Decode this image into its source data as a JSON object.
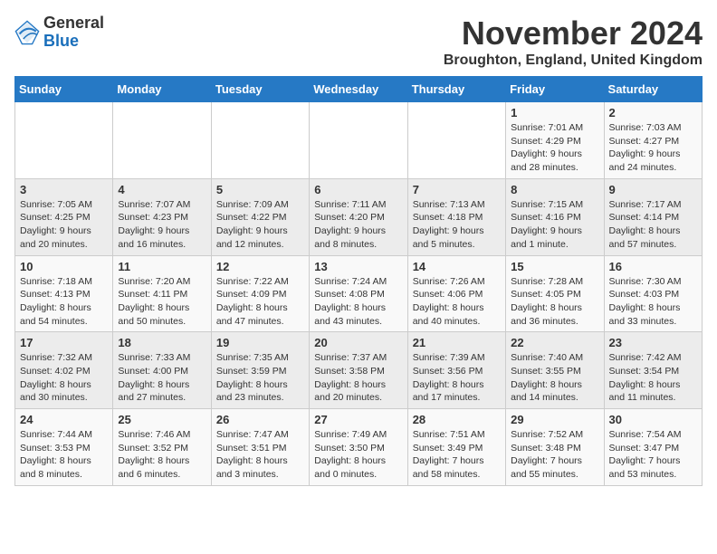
{
  "logo": {
    "general": "General",
    "blue": "Blue"
  },
  "header": {
    "month": "November 2024",
    "location": "Broughton, England, United Kingdom"
  },
  "days_of_week": [
    "Sunday",
    "Monday",
    "Tuesday",
    "Wednesday",
    "Thursday",
    "Friday",
    "Saturday"
  ],
  "weeks": [
    [
      {
        "day": "",
        "info": ""
      },
      {
        "day": "",
        "info": ""
      },
      {
        "day": "",
        "info": ""
      },
      {
        "day": "",
        "info": ""
      },
      {
        "day": "",
        "info": ""
      },
      {
        "day": "1",
        "info": "Sunrise: 7:01 AM\nSunset: 4:29 PM\nDaylight: 9 hours and 28 minutes."
      },
      {
        "day": "2",
        "info": "Sunrise: 7:03 AM\nSunset: 4:27 PM\nDaylight: 9 hours and 24 minutes."
      }
    ],
    [
      {
        "day": "3",
        "info": "Sunrise: 7:05 AM\nSunset: 4:25 PM\nDaylight: 9 hours and 20 minutes."
      },
      {
        "day": "4",
        "info": "Sunrise: 7:07 AM\nSunset: 4:23 PM\nDaylight: 9 hours and 16 minutes."
      },
      {
        "day": "5",
        "info": "Sunrise: 7:09 AM\nSunset: 4:22 PM\nDaylight: 9 hours and 12 minutes."
      },
      {
        "day": "6",
        "info": "Sunrise: 7:11 AM\nSunset: 4:20 PM\nDaylight: 9 hours and 8 minutes."
      },
      {
        "day": "7",
        "info": "Sunrise: 7:13 AM\nSunset: 4:18 PM\nDaylight: 9 hours and 5 minutes."
      },
      {
        "day": "8",
        "info": "Sunrise: 7:15 AM\nSunset: 4:16 PM\nDaylight: 9 hours and 1 minute."
      },
      {
        "day": "9",
        "info": "Sunrise: 7:17 AM\nSunset: 4:14 PM\nDaylight: 8 hours and 57 minutes."
      }
    ],
    [
      {
        "day": "10",
        "info": "Sunrise: 7:18 AM\nSunset: 4:13 PM\nDaylight: 8 hours and 54 minutes."
      },
      {
        "day": "11",
        "info": "Sunrise: 7:20 AM\nSunset: 4:11 PM\nDaylight: 8 hours and 50 minutes."
      },
      {
        "day": "12",
        "info": "Sunrise: 7:22 AM\nSunset: 4:09 PM\nDaylight: 8 hours and 47 minutes."
      },
      {
        "day": "13",
        "info": "Sunrise: 7:24 AM\nSunset: 4:08 PM\nDaylight: 8 hours and 43 minutes."
      },
      {
        "day": "14",
        "info": "Sunrise: 7:26 AM\nSunset: 4:06 PM\nDaylight: 8 hours and 40 minutes."
      },
      {
        "day": "15",
        "info": "Sunrise: 7:28 AM\nSunset: 4:05 PM\nDaylight: 8 hours and 36 minutes."
      },
      {
        "day": "16",
        "info": "Sunrise: 7:30 AM\nSunset: 4:03 PM\nDaylight: 8 hours and 33 minutes."
      }
    ],
    [
      {
        "day": "17",
        "info": "Sunrise: 7:32 AM\nSunset: 4:02 PM\nDaylight: 8 hours and 30 minutes."
      },
      {
        "day": "18",
        "info": "Sunrise: 7:33 AM\nSunset: 4:00 PM\nDaylight: 8 hours and 27 minutes."
      },
      {
        "day": "19",
        "info": "Sunrise: 7:35 AM\nSunset: 3:59 PM\nDaylight: 8 hours and 23 minutes."
      },
      {
        "day": "20",
        "info": "Sunrise: 7:37 AM\nSunset: 3:58 PM\nDaylight: 8 hours and 20 minutes."
      },
      {
        "day": "21",
        "info": "Sunrise: 7:39 AM\nSunset: 3:56 PM\nDaylight: 8 hours and 17 minutes."
      },
      {
        "day": "22",
        "info": "Sunrise: 7:40 AM\nSunset: 3:55 PM\nDaylight: 8 hours and 14 minutes."
      },
      {
        "day": "23",
        "info": "Sunrise: 7:42 AM\nSunset: 3:54 PM\nDaylight: 8 hours and 11 minutes."
      }
    ],
    [
      {
        "day": "24",
        "info": "Sunrise: 7:44 AM\nSunset: 3:53 PM\nDaylight: 8 hours and 8 minutes."
      },
      {
        "day": "25",
        "info": "Sunrise: 7:46 AM\nSunset: 3:52 PM\nDaylight: 8 hours and 6 minutes."
      },
      {
        "day": "26",
        "info": "Sunrise: 7:47 AM\nSunset: 3:51 PM\nDaylight: 8 hours and 3 minutes."
      },
      {
        "day": "27",
        "info": "Sunrise: 7:49 AM\nSunset: 3:50 PM\nDaylight: 8 hours and 0 minutes."
      },
      {
        "day": "28",
        "info": "Sunrise: 7:51 AM\nSunset: 3:49 PM\nDaylight: 7 hours and 58 minutes."
      },
      {
        "day": "29",
        "info": "Sunrise: 7:52 AM\nSunset: 3:48 PM\nDaylight: 7 hours and 55 minutes."
      },
      {
        "day": "30",
        "info": "Sunrise: 7:54 AM\nSunset: 3:47 PM\nDaylight: 7 hours and 53 minutes."
      }
    ]
  ]
}
